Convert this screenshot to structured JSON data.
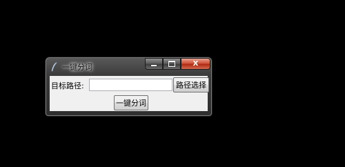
{
  "window": {
    "title": "一键分词",
    "icon": "feather-icon",
    "controls": {
      "minimize": "minimize-icon",
      "maximize": "maximize-icon",
      "close": "close-icon",
      "close_symbol": "X"
    }
  },
  "form": {
    "target_path_label": "目标路径:",
    "target_path_value": "",
    "browse_button": "路径选择",
    "segment_button": "一键分词"
  },
  "colors": {
    "desktop": "#000000",
    "close_button": "#c7432b",
    "client_area": "#f0f0f0"
  }
}
